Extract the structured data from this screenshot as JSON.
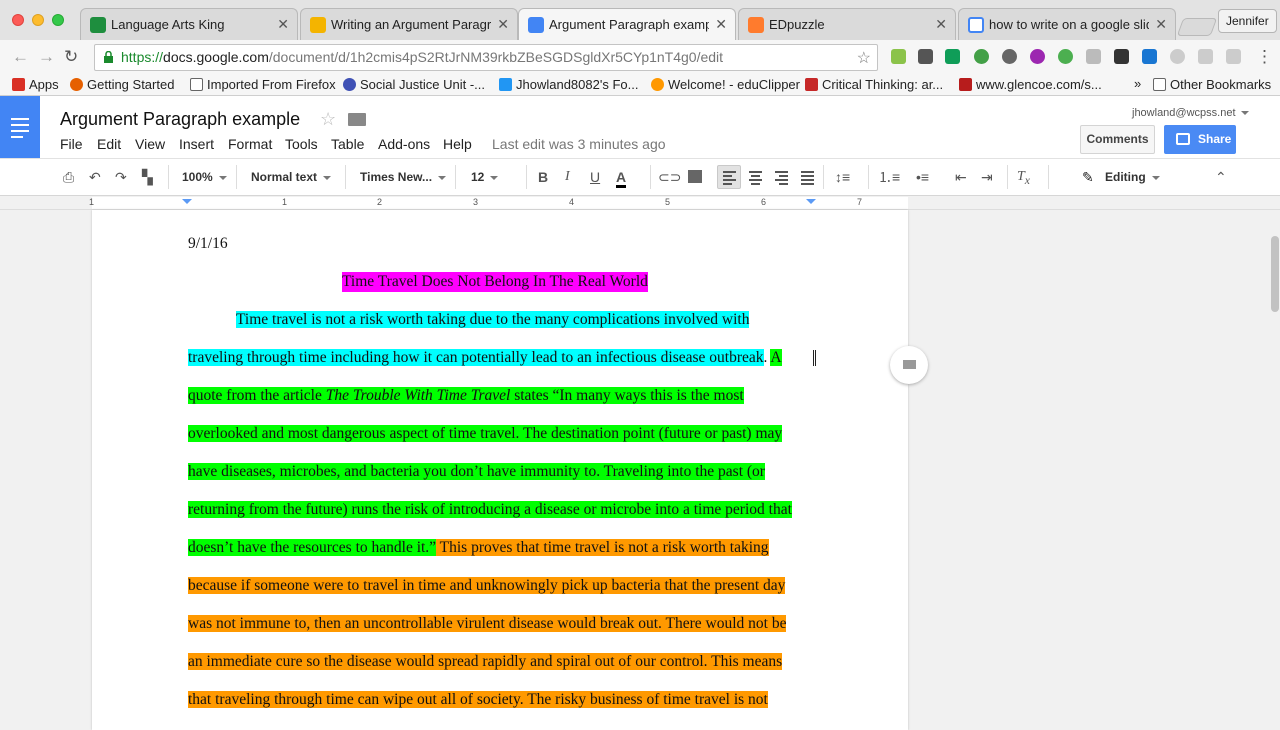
{
  "browser": {
    "tabs": [
      {
        "title": "Language Arts King",
        "active": false,
        "favicon": "classroom-icon",
        "color": "#1e8e3e"
      },
      {
        "title": "Writing an Argument Paragra",
        "active": false,
        "favicon": "slides-icon",
        "color": "#f4b400"
      },
      {
        "title": "Argument Paragraph example",
        "active": true,
        "favicon": "docs-icon",
        "color": "#4285f4"
      },
      {
        "title": "EDpuzzle",
        "active": false,
        "favicon": "edpuzzle-icon",
        "color": "#ff7b2d"
      },
      {
        "title": "how to write on a google slid",
        "active": false,
        "favicon": "google-icon",
        "color": "#4285f4"
      }
    ],
    "user": "Jennifer",
    "url": {
      "scheme": "https://",
      "host": "docs.google.com",
      "path": "/document/d/1h2cmis4pS2RtJrNM39rkbZBeSGDSgldXr5CYp1nT4g0/edit"
    },
    "bookmarks": [
      {
        "label": "Apps",
        "icon": "apps-icon"
      },
      {
        "label": "Getting Started",
        "icon": "firefox-icon"
      },
      {
        "label": "Imported From Firefox",
        "icon": "folder-icon"
      },
      {
        "label": "Social Justice Unit -...",
        "icon": "globe-icon"
      },
      {
        "label": "Jhowland8082's Fo...",
        "icon": "bookmark-icon"
      },
      {
        "label": "Welcome! - eduClipper",
        "icon": "educlipper-icon"
      },
      {
        "label": "Critical Thinking: ar...",
        "icon": "site-icon"
      },
      {
        "label": "www.glencoe.com/s...",
        "icon": "glencoe-icon"
      },
      {
        "label": "»",
        "icon": ""
      },
      {
        "label": "Other Bookmarks",
        "icon": "folder-icon"
      }
    ]
  },
  "docs": {
    "title": "Argument Paragraph example",
    "menus": [
      "File",
      "Edit",
      "View",
      "Insert",
      "Format",
      "Tools",
      "Table",
      "Add-ons",
      "Help"
    ],
    "last_edit": "Last edit was 3 minutes ago",
    "email": "jhowland@wcpss.net",
    "comments_label": "Comments",
    "share_label": "Share",
    "toolbar": {
      "zoom": "100%",
      "style": "Normal text",
      "font": "Times New...",
      "size": "12",
      "mode": "Editing"
    },
    "ruler_numbers": [
      "1",
      "1",
      "2",
      "3",
      "4",
      "5",
      "6",
      "7"
    ]
  },
  "document": {
    "date": "9/1/16",
    "heading": "Time Travel Does Not Belong In The Real World",
    "lines": [
      {
        "segments": [
          {
            "text": "Time travel is not a risk worth taking due to the many complications involved with",
            "hl": "cyan"
          }
        ]
      },
      {
        "segments": [
          {
            "text": "traveling through time including how it can potentially lead to an infectious disease outbreak",
            "hl": "cyan"
          },
          {
            "text": ". ",
            "hl": "none"
          },
          {
            "text": "A",
            "hl": "green"
          }
        ]
      },
      {
        "segments": [
          {
            "text": "quote from the article ",
            "hl": "green"
          },
          {
            "text": "The Trouble With Time Travel",
            "hl": "green",
            "italic": true
          },
          {
            "text": " states “In many ways this is the most",
            "hl": "green"
          }
        ]
      },
      {
        "segments": [
          {
            "text": "overlooked and most dangerous aspect of time travel. The destination point (future or past) may",
            "hl": "green"
          }
        ]
      },
      {
        "segments": [
          {
            "text": "have diseases, microbes, and bacteria you don’t have immunity to. Traveling into the past (or",
            "hl": "green"
          }
        ]
      },
      {
        "segments": [
          {
            "text": "returning from the future) runs the risk of introducing a disease or microbe into a time period that",
            "hl": "green"
          }
        ]
      },
      {
        "segments": [
          {
            "text": "doesn’t have the resources to handle it.”",
            "hl": "green"
          },
          {
            "text": " This proves that time travel is not a risk worth taking",
            "hl": "orange"
          }
        ]
      },
      {
        "segments": [
          {
            "text": "because if someone were to travel in time and unknowingly pick up bacteria that the present day",
            "hl": "orange"
          }
        ]
      },
      {
        "segments": [
          {
            "text": "was not immune to, then an uncontrollable virulent disease would break out. There would not be",
            "hl": "orange"
          }
        ]
      },
      {
        "segments": [
          {
            "text": "an immediate cure so the disease would spread rapidly and spiral out of our control. This means",
            "hl": "orange"
          }
        ]
      },
      {
        "segments": [
          {
            "text": "that traveling through time can wipe out all of society. The risky business of time travel is not",
            "hl": "orange"
          }
        ]
      }
    ]
  }
}
